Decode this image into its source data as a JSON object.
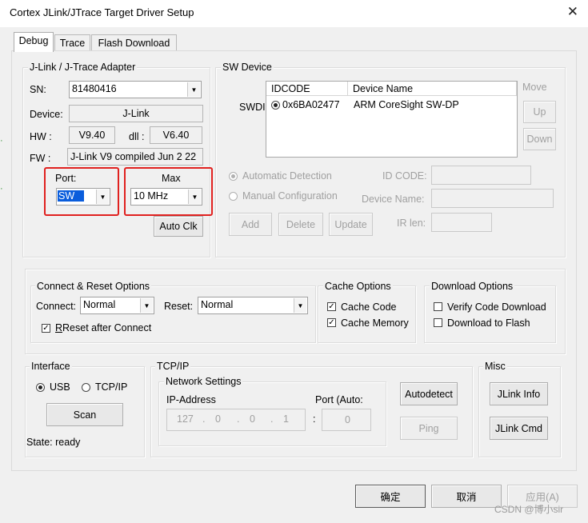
{
  "window": {
    "title": "Cortex JLink/JTrace Target Driver Setup"
  },
  "tabs": [
    {
      "label": "Debug",
      "active": true
    },
    {
      "label": "Trace",
      "active": false
    },
    {
      "label": "Flash Download",
      "active": false
    }
  ],
  "adapter": {
    "group_label": "J-Link / J-Trace Adapter",
    "sn_label": "SN:",
    "sn_value": "81480416",
    "device_label": "Device:",
    "device_value": "J-Link",
    "hw_label": "HW :",
    "hw_value": "V9.40",
    "dll_label": "dll :",
    "dll_value": "V6.40",
    "fw_label": "FW :",
    "fw_value": "J-Link V9 compiled Jun  2 22",
    "port_label": "Port:",
    "port_value": "SW",
    "max_label": "Max",
    "max_value": "10 MHz",
    "autoclk_label": "Auto Clk"
  },
  "sw_device": {
    "group_label": "SW Device",
    "side_label": "SWDI",
    "col_idcode": "IDCODE",
    "col_device_name": "Device Name",
    "row_idcode": "0x6BA02477",
    "row_device_name": "ARM CoreSight SW-DP",
    "move_label": "Move",
    "up_label": "Up",
    "down_label": "Down",
    "auto_detection": "Automatic Detection",
    "manual_config": "Manual Configuration",
    "id_code_label": "ID CODE:",
    "device_name_label": "Device Name:",
    "ir_len_label": "IR len:",
    "add_label": "Add",
    "delete_label": "Delete",
    "update_label": "Update"
  },
  "connect_reset": {
    "group_label": "Connect & Reset Options",
    "connect_label": "Connect:",
    "connect_value": "Normal",
    "reset_label": "Reset:",
    "reset_value": "Normal",
    "reset_after_connect": "Reset after Connect"
  },
  "cache_options": {
    "group_label": "Cache Options",
    "cache_code": "Cache Code",
    "cache_memory": "Cache Memory"
  },
  "download_options": {
    "group_label": "Download Options",
    "verify_code": "Verify Code Download",
    "download_flash": "Download to Flash"
  },
  "interface": {
    "group_label": "Interface",
    "usb_label": "USB",
    "tcpip_label": "TCP/IP",
    "scan_label": "Scan",
    "state_text": "State: ready"
  },
  "tcpip": {
    "group_label": "TCP/IP",
    "network_label": "Network Settings",
    "ip_label": "IP-Address",
    "port_label": "Port (Auto:",
    "ip_octets": [
      "127",
      "0",
      "0",
      "1"
    ],
    "ip_dots": [
      ".",
      ".",
      "."
    ],
    "colon": ":",
    "port_value": "0",
    "autodetect_label": "Autodetect",
    "ping_label": "Ping"
  },
  "misc": {
    "group_label": "Misc",
    "jlink_info": "JLink Info",
    "jlink_cmd": "JLink Cmd"
  },
  "footer": {
    "ok_label": "确定",
    "cancel_label": "取消",
    "apply_label": "应用(A)",
    "watermark": "CSDN @博小sir"
  }
}
